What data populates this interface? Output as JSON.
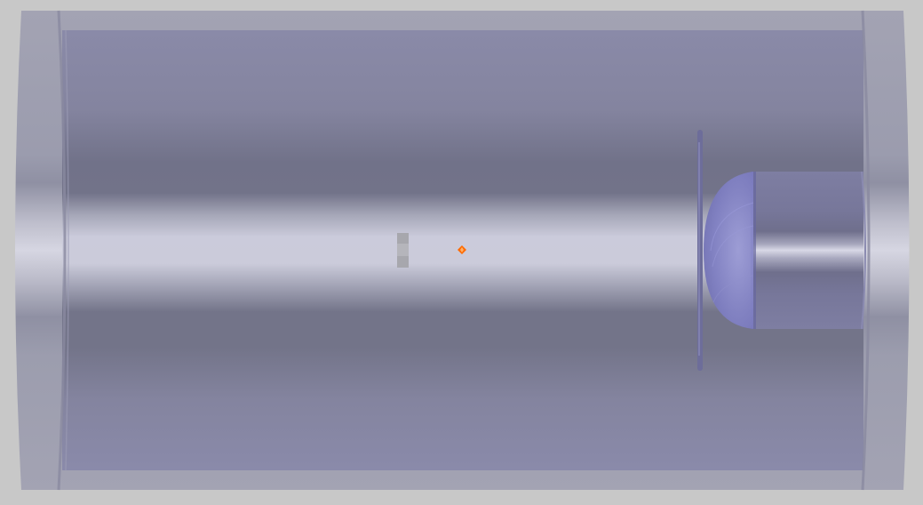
{
  "scene": {
    "background_color": "#c8c8c8",
    "outer_tube_color": "#a0a0b4",
    "inner_body_color": "#8888aa",
    "highlight_color": "#d4d4e2",
    "shadow_color": "#6f7086",
    "lens_color": "#8282c0",
    "source_marker_color": "#ff6a00",
    "small_block_color": "#a7a7ad",
    "objects": [
      {
        "name": "outer-cylinder",
        "kind": "tube"
      },
      {
        "name": "inner-cylinder",
        "kind": "tube"
      },
      {
        "name": "left-end-cap",
        "kind": "ring"
      },
      {
        "name": "right-end-cap",
        "kind": "ring"
      },
      {
        "name": "aperture-disk",
        "kind": "disk"
      },
      {
        "name": "hemispherical-lens",
        "kind": "lens"
      },
      {
        "name": "detector-cylinder",
        "kind": "cylinder"
      },
      {
        "name": "small-block",
        "kind": "block"
      },
      {
        "name": "source-marker",
        "kind": "point"
      }
    ]
  }
}
